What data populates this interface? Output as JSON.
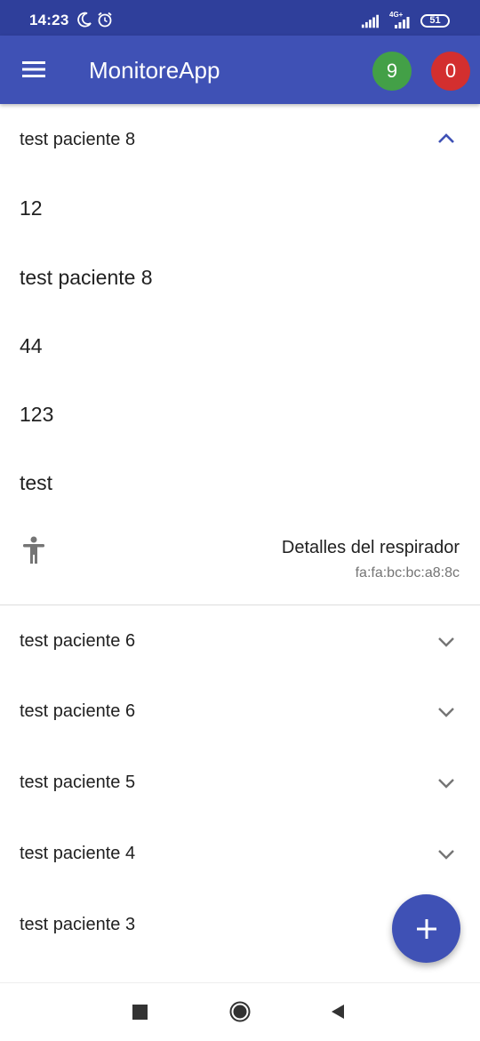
{
  "status_bar": {
    "time": "14:23",
    "network_label": "4G+",
    "battery": "51",
    "icons": [
      "moon-icon",
      "alarm-icon",
      "signal-icon",
      "signal-4g-icon",
      "battery-icon"
    ]
  },
  "appbar": {
    "title": "MonitoreApp",
    "badge_green_count": "9",
    "badge_red_count": "0",
    "colors": {
      "bar": "#3f51b5",
      "status": "#2f3f9b",
      "green": "#43a047",
      "red": "#d32f2f"
    }
  },
  "expanded_patient": {
    "title": "test paciente 8",
    "fields": [
      "12",
      "test paciente 8",
      "44",
      "123",
      "test"
    ],
    "details_label": "Detalles del respirador",
    "mac_address": "fa:fa:bc:bc:a8:8c"
  },
  "patients": [
    {
      "name": "test paciente 6"
    },
    {
      "name": "test paciente 6"
    },
    {
      "name": "test paciente 5"
    },
    {
      "name": "test paciente 4"
    },
    {
      "name": "test paciente 3"
    }
  ],
  "fab": {
    "icon": "plus-icon"
  },
  "nav": {
    "icons": [
      "recents-icon",
      "home-icon",
      "back-icon"
    ]
  }
}
